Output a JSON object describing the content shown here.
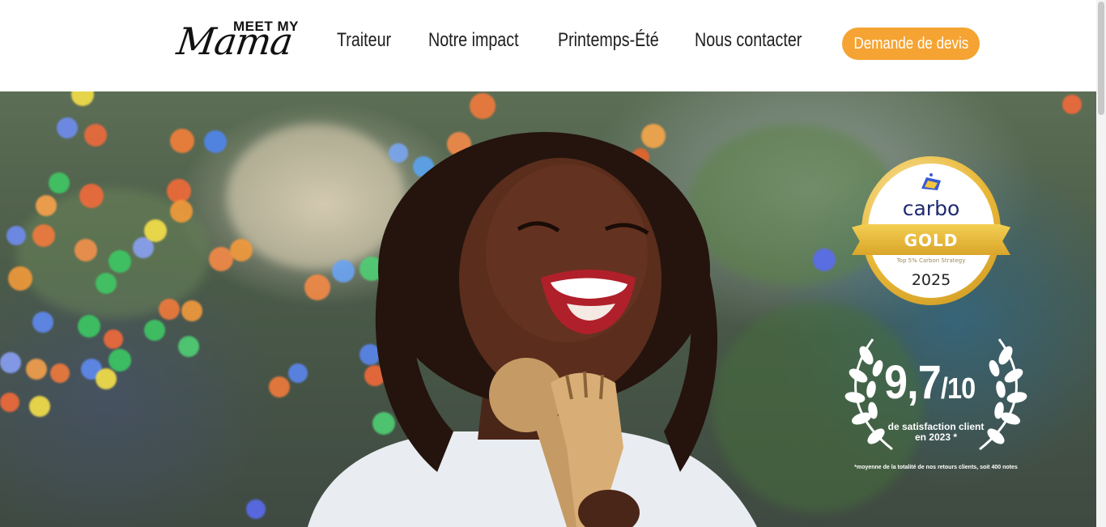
{
  "header": {
    "logo": {
      "top_text": "MEET MY",
      "script_text": "Mama"
    },
    "nav": [
      {
        "label": "Traiteur"
      },
      {
        "label": "Notre impact"
      },
      {
        "label": "Printemps-Été"
      },
      {
        "label": "Nous contacter"
      }
    ],
    "cta_label": "Demande de devis"
  },
  "hero": {
    "badge": {
      "brand": "carbo",
      "level": "GOLD",
      "subtitle": "Top 5% Carbon Strategy",
      "year": "2025"
    },
    "rating": {
      "score": "9,7",
      "denominator": "/10",
      "label_line1": "de satisfaction client",
      "label_line2": "en 2023 *",
      "footnote": "*moyenne de la totalité de nos retours clients, soit 400 notes"
    }
  },
  "colors": {
    "accent": "#f5a332",
    "nav_text": "#1e1e1e",
    "badge_gold": "#e8b737",
    "badge_brand": "#1f2a6e"
  },
  "icons": [
    "carbo-logo-icon",
    "laurel-left-icon",
    "laurel-right-icon"
  ]
}
